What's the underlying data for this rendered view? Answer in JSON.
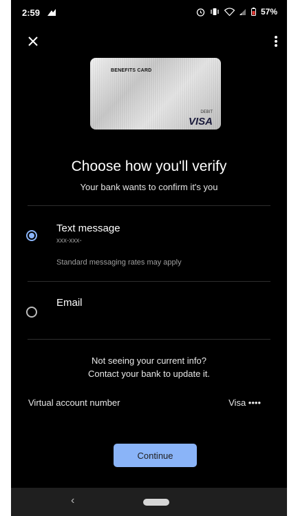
{
  "status_bar": {
    "time": "2:59",
    "battery": "57%",
    "icons": [
      "alarm-icon",
      "vibrate-icon",
      "wifi-icon",
      "signal-icon",
      "battery-icon"
    ]
  },
  "app_bar": {
    "close_icon": "close-icon",
    "more_icon": "more-vert-icon"
  },
  "card": {
    "title": "BENEFITS CARD",
    "debit_label": "DEBIT",
    "brand": "VISA"
  },
  "heading": "Choose how you'll verify",
  "subheading": "Your bank wants to confirm it's you",
  "options": [
    {
      "label": "Text message",
      "value": "xxx-xxx-",
      "note": "Standard messaging rates may apply",
      "selected": true
    },
    {
      "label": "Email",
      "selected": false
    }
  ],
  "contact": {
    "line1": "Not seeing your current info?",
    "line2": "Contact your bank to update it."
  },
  "account_row": {
    "label": "Virtual account number",
    "value": "Visa ••••"
  },
  "continue_label": "Continue",
  "nav": {
    "back_icon": "back-icon",
    "home_icon": "home-pill-icon"
  },
  "colors": {
    "background": "#000000",
    "accent": "#8ab4f8",
    "nav_bar": "#1f1f1f"
  }
}
